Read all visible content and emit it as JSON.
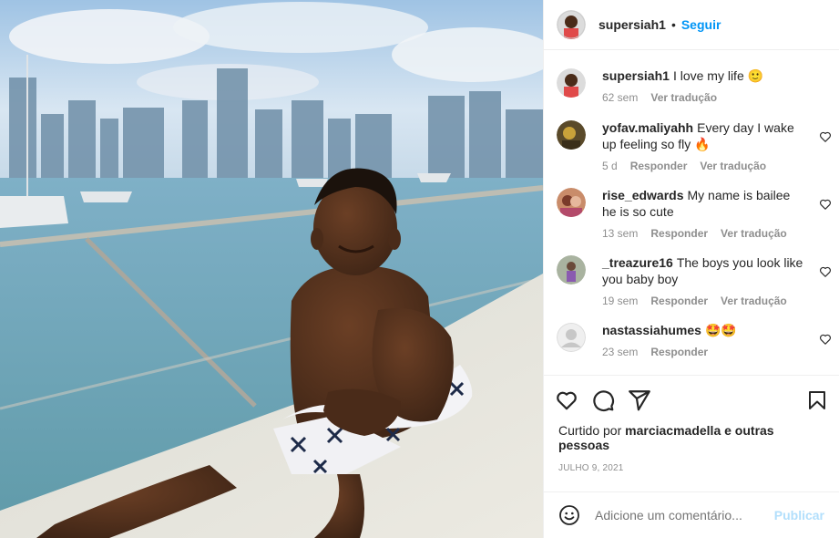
{
  "post": {
    "username": "supersiah1",
    "follow_label": "Seguir",
    "dot": "•"
  },
  "caption": {
    "username": "supersiah1",
    "text": "I love my life 🙂",
    "time": "62 sem",
    "translate": "Ver tradução"
  },
  "comments": [
    {
      "username": "yofav.maliyahh",
      "text": "Every day I wake up feeling so fly 🔥",
      "time": "5 d",
      "reply": "Responder",
      "translate": "Ver tradução"
    },
    {
      "username": "rise_edwards",
      "text": "My name is bailee he is so cute",
      "time": "13 sem",
      "reply": "Responder",
      "translate": "Ver tradução"
    },
    {
      "username": "_treazure16",
      "text": "The boys you look like you baby boy",
      "time": "19 sem",
      "reply": "Responder",
      "translate": "Ver tradução"
    },
    {
      "username": "nastassiahumes",
      "text": "🤩🤩",
      "time": "23 sem",
      "reply": "Responder",
      "translate": ""
    }
  ],
  "likes": {
    "prefix": "Curtido por",
    "user": "marciacmadella",
    "suffix": "e outras pessoas"
  },
  "date": "JULHO 9, 2021",
  "add_comment": {
    "placeholder": "Adicione um comentário...",
    "publish": "Publicar"
  },
  "colors": {
    "accent": "#0095f6",
    "publish_disabled": "#b2dffc",
    "muted": "#8e8e8e"
  },
  "icons": [
    "heart-icon",
    "comment-icon",
    "share-icon",
    "bookmark-icon",
    "emoji-icon"
  ]
}
